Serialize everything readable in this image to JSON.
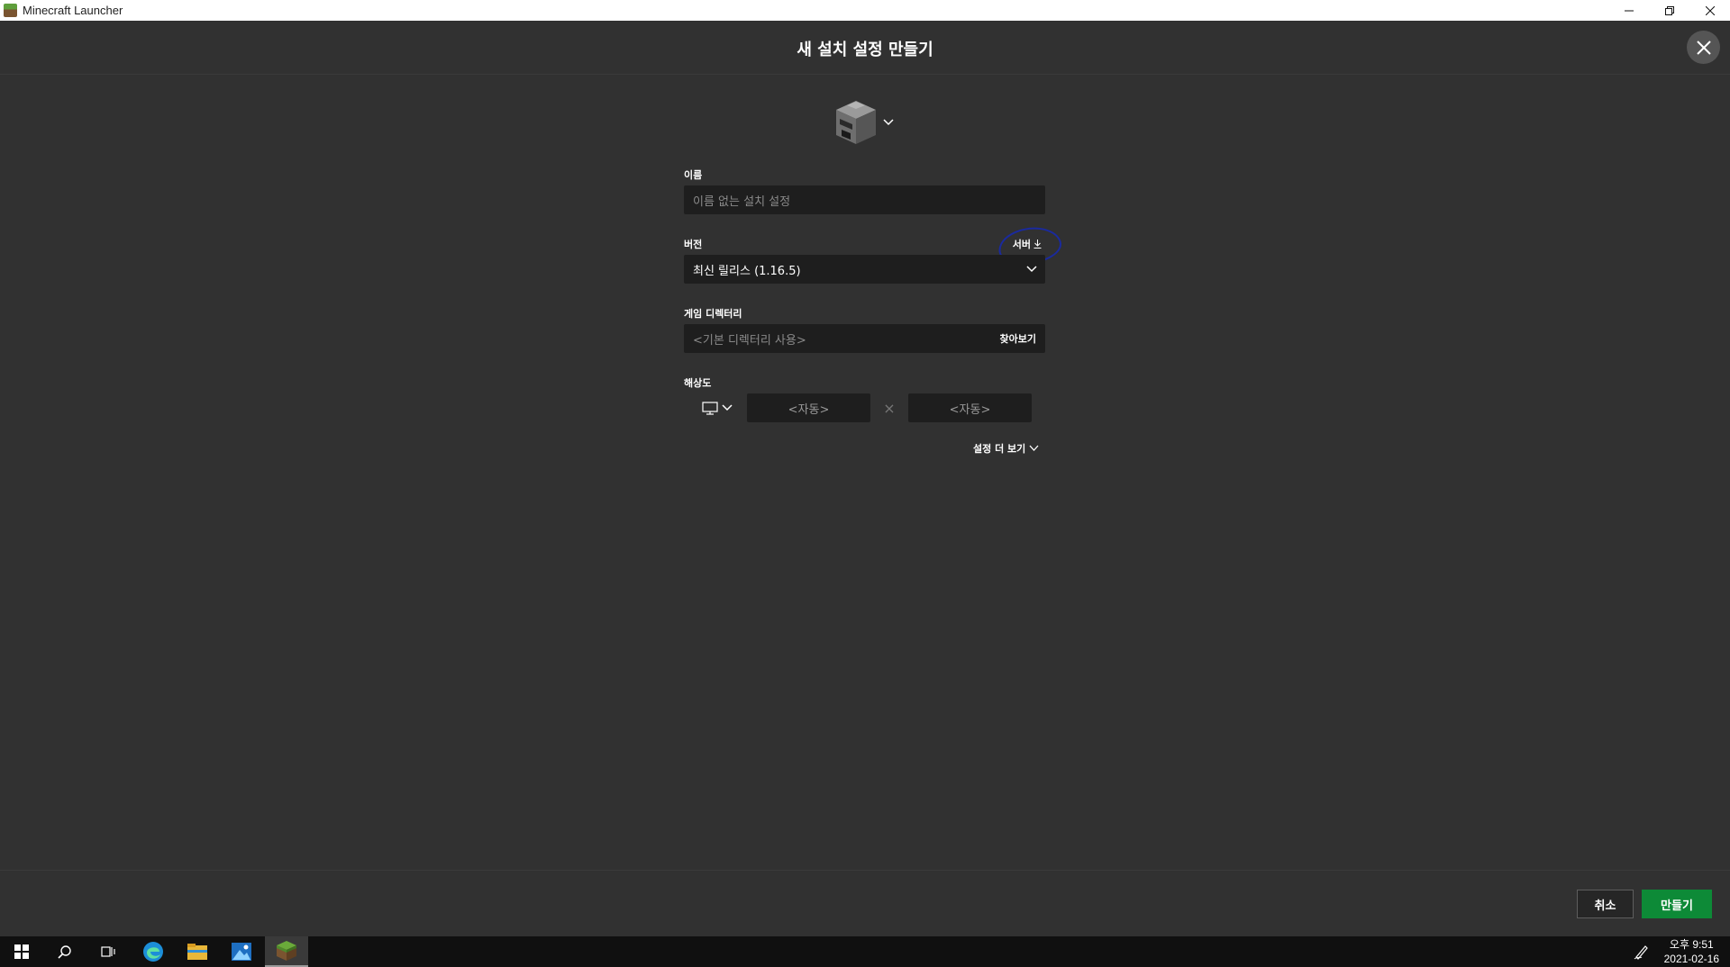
{
  "window": {
    "title": "Minecraft Launcher"
  },
  "dialog": {
    "title": "새 설치 설정 만들기"
  },
  "form": {
    "name_label": "이름",
    "name_placeholder": "이름 없는 설치 설정",
    "version_label": "버전",
    "server_link": "서버",
    "version_value": "최신 릴리스 (1.16.5)",
    "dir_label": "게임 디렉터리",
    "dir_placeholder": "<기본 디렉터리 사용>",
    "browse_label": "찾아보기",
    "resolution_label": "해상도",
    "width_placeholder": "<자동>",
    "height_placeholder": "<자동>",
    "times": "×",
    "more_settings": "설정 더 보기"
  },
  "footer": {
    "cancel_label": "취소",
    "create_label": "만들기"
  },
  "taskbar": {
    "time": "오후 9:51",
    "date": "2021-02-16"
  },
  "colors": {
    "background": "#313131",
    "field": "#1e1e1e",
    "accent_green": "#0d8a37",
    "annotation_circle": "#1a2a9e"
  }
}
